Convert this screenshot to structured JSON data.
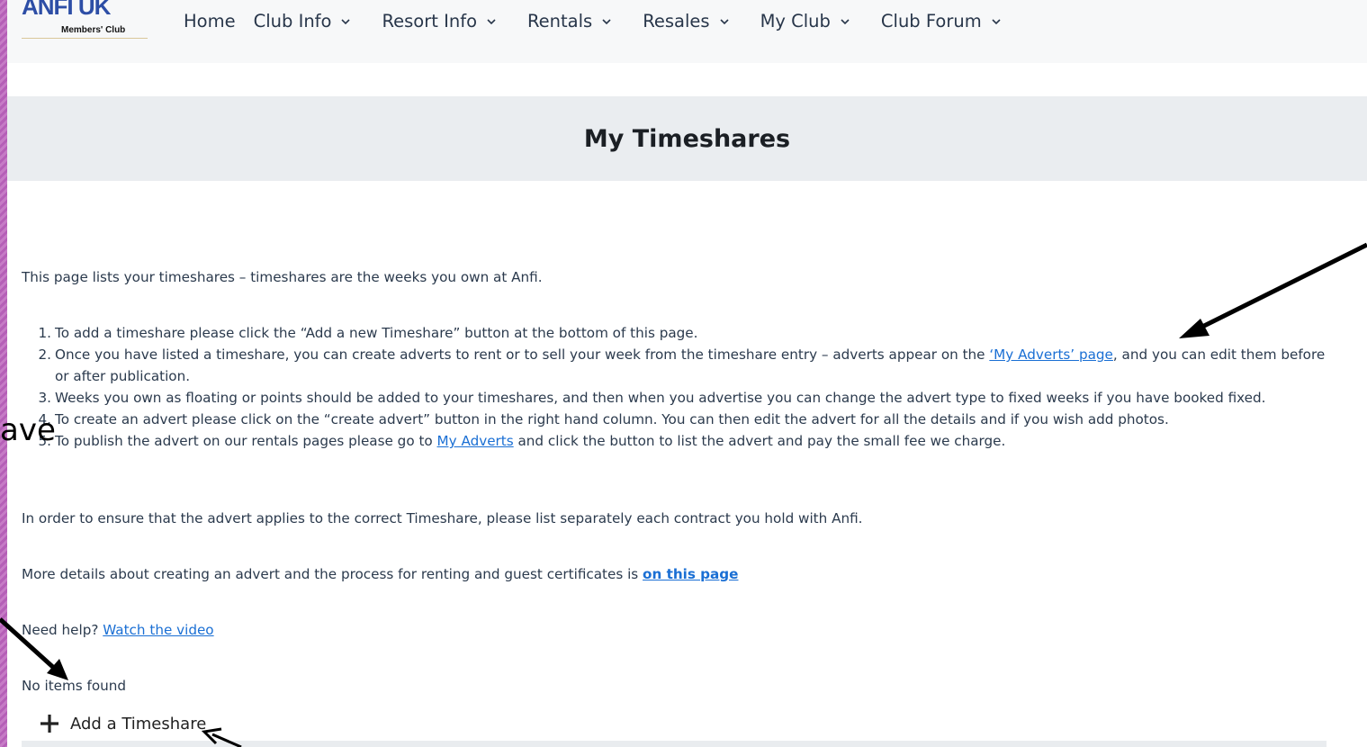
{
  "header": {
    "logo": {
      "main": "ANFI UK",
      "sub": "Members' Club"
    },
    "nav": [
      {
        "label": "Home",
        "has_dropdown": false
      },
      {
        "label": "Club Info",
        "has_dropdown": true
      },
      {
        "label": "Resort Info",
        "has_dropdown": true
      },
      {
        "label": "Rentals",
        "has_dropdown": true
      },
      {
        "label": "Resales",
        "has_dropdown": true
      },
      {
        "label": "My Club",
        "has_dropdown": true
      },
      {
        "label": "Club Forum",
        "has_dropdown": true
      }
    ]
  },
  "page": {
    "title": "My Timeshares",
    "intro": "This page lists your timeshares – timeshares are the weeks you own at Anfi.",
    "steps": [
      {
        "num": "1.",
        "text": "To add a timeshare please click the “Add a new Timeshare” button at the bottom of this page."
      },
      {
        "num": "2.",
        "before": "Once you have listed a timeshare, you can create adverts to rent or to sell your week from the timeshare entry – adverts appear on the ",
        "link": "‘My Adverts’ page",
        "after": ", and you can edit them before or after publication."
      },
      {
        "num": "3.",
        "text": "Weeks you own as floating or points should be added to your timeshares, and then when you advertise you can change the advert type to fixed weeks if you have booked fixed."
      },
      {
        "num": "4.",
        "text": "To create an advert please click on the “create advert” button in the right hand column. You can then edit the advert for all the details and if you wish add photos."
      },
      {
        "num": "5.",
        "before": "To publish the advert on our rentals pages please go to ",
        "link": "My Adverts",
        "after": " and click the button to list the advert and pay the small fee we charge."
      }
    ],
    "contract_note": "In order to ensure that the advert applies to the correct Timeshare, please list separately each contract you hold with Anfi.",
    "more_details": {
      "before": "More details about creating an advert and the process for renting and guest certificates is ",
      "link": "on this page"
    },
    "help": {
      "before": "Need help? ",
      "link": "Watch the video"
    },
    "empty_state": "No items found",
    "add_button": "Add a Timeshare"
  },
  "overlay": {
    "text": "ave"
  },
  "colors": {
    "link": "#1a6fd4",
    "title_band": "#eaedf0",
    "logo_blue": "#2d4ea6",
    "border_purple": "#b55fb7"
  }
}
